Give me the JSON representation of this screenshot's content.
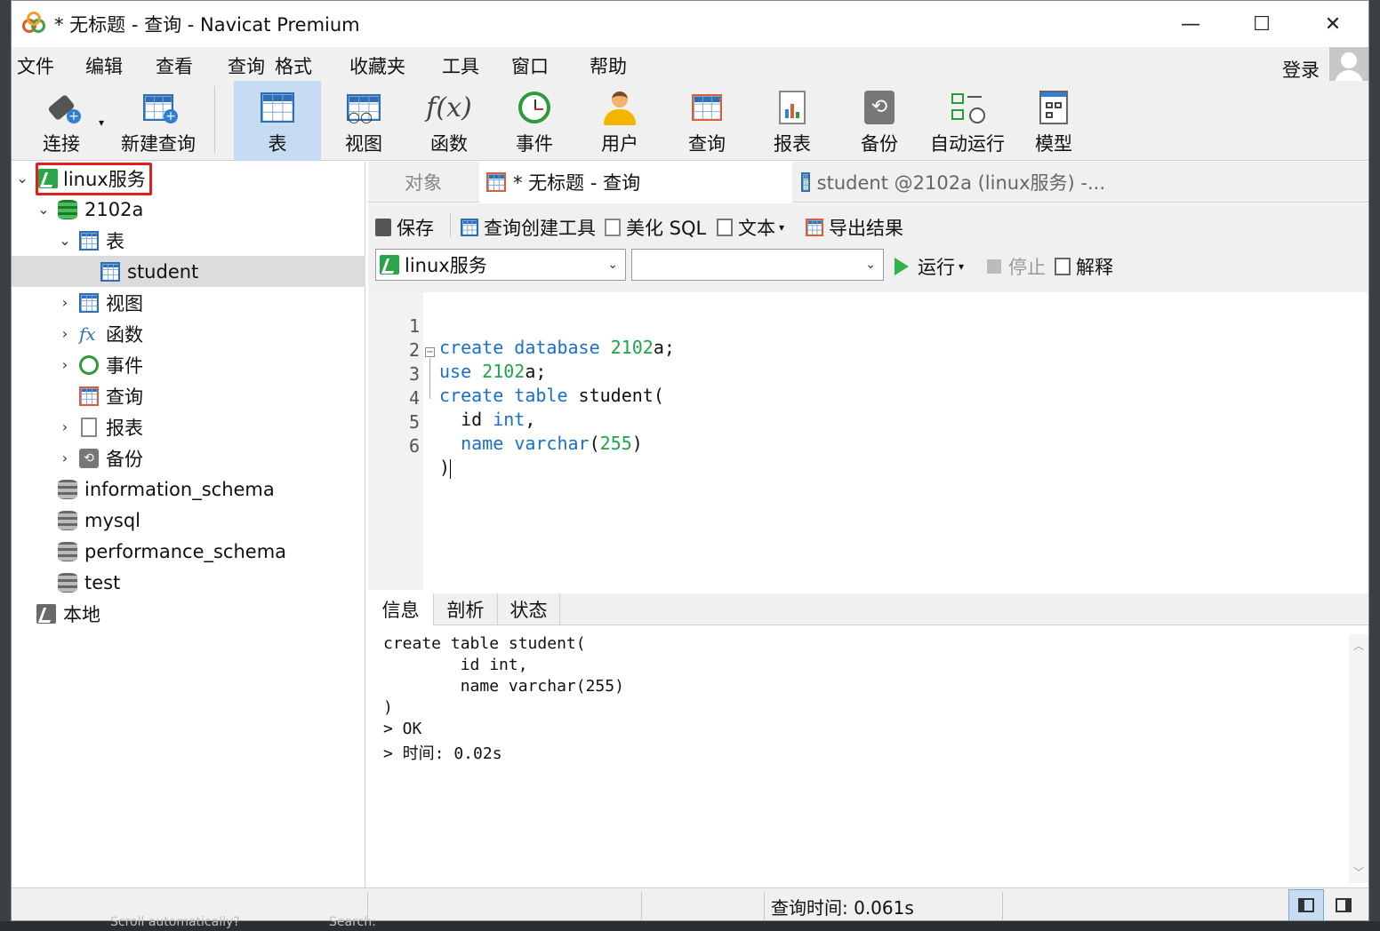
{
  "window": {
    "title": "* 无标题 - 查询 - Navicat Premium",
    "minimize": "—",
    "maximize": "☐",
    "close": "✕"
  },
  "menu": {
    "items": [
      "文件",
      "编辑",
      "查看",
      "查询",
      "格式",
      "收藏夹",
      "工具",
      "窗口",
      "帮助"
    ],
    "login": "登录"
  },
  "toolbar": {
    "connect": "连接",
    "new_query": "新建查询",
    "table": "表",
    "view": "视图",
    "function": "函数",
    "event": "事件",
    "user": "用户",
    "query": "查询",
    "report": "报表",
    "backup": "备份",
    "auto_run": "自动运行",
    "model": "模型"
  },
  "tree": {
    "connection": "linux服务",
    "database": "2102a",
    "tables_group": "表",
    "table_student": "student",
    "views": "视图",
    "functions": "函数",
    "events": "事件",
    "queries": "查询",
    "reports": "报表",
    "backups": "备份",
    "db_info_schema": "information_schema",
    "db_mysql": "mysql",
    "db_perf_schema": "performance_schema",
    "db_test": "test",
    "local_connection": "本地"
  },
  "tabs": {
    "objects": "对象",
    "query_tab": "* 无标题 - 查询",
    "student_tab": "student @2102a (linux服务) -..."
  },
  "query_toolbar": {
    "save": "保存",
    "query_builder": "查询创建工具",
    "beautify": "美化 SQL",
    "text": "文本",
    "export": "导出结果",
    "connection_value": "linux服务",
    "database_value": "",
    "run": "运行",
    "stop": "停止",
    "explain": "解释"
  },
  "editor": {
    "line_numbers": [
      "1",
      "2",
      "3",
      "4",
      "5",
      "6"
    ]
  },
  "output_tabs": {
    "info": "信息",
    "profile": "剖析",
    "status": "状态"
  },
  "output": {
    "lines": [
      "create table student(",
      "        id int,",
      "        name varchar(255)",
      ")",
      "> OK",
      "> 时间: 0.02s"
    ]
  },
  "status": {
    "query_time": "查询时间: 0.061s"
  },
  "background": {
    "scroll_text": "Scroll automatically?",
    "search_text": "Search:"
  },
  "colors": {
    "keyword": "#1a6fc7",
    "number": "#1ea44a",
    "highlight_box": "#e0201b",
    "active_tab_bg": "#c5dcf2"
  }
}
